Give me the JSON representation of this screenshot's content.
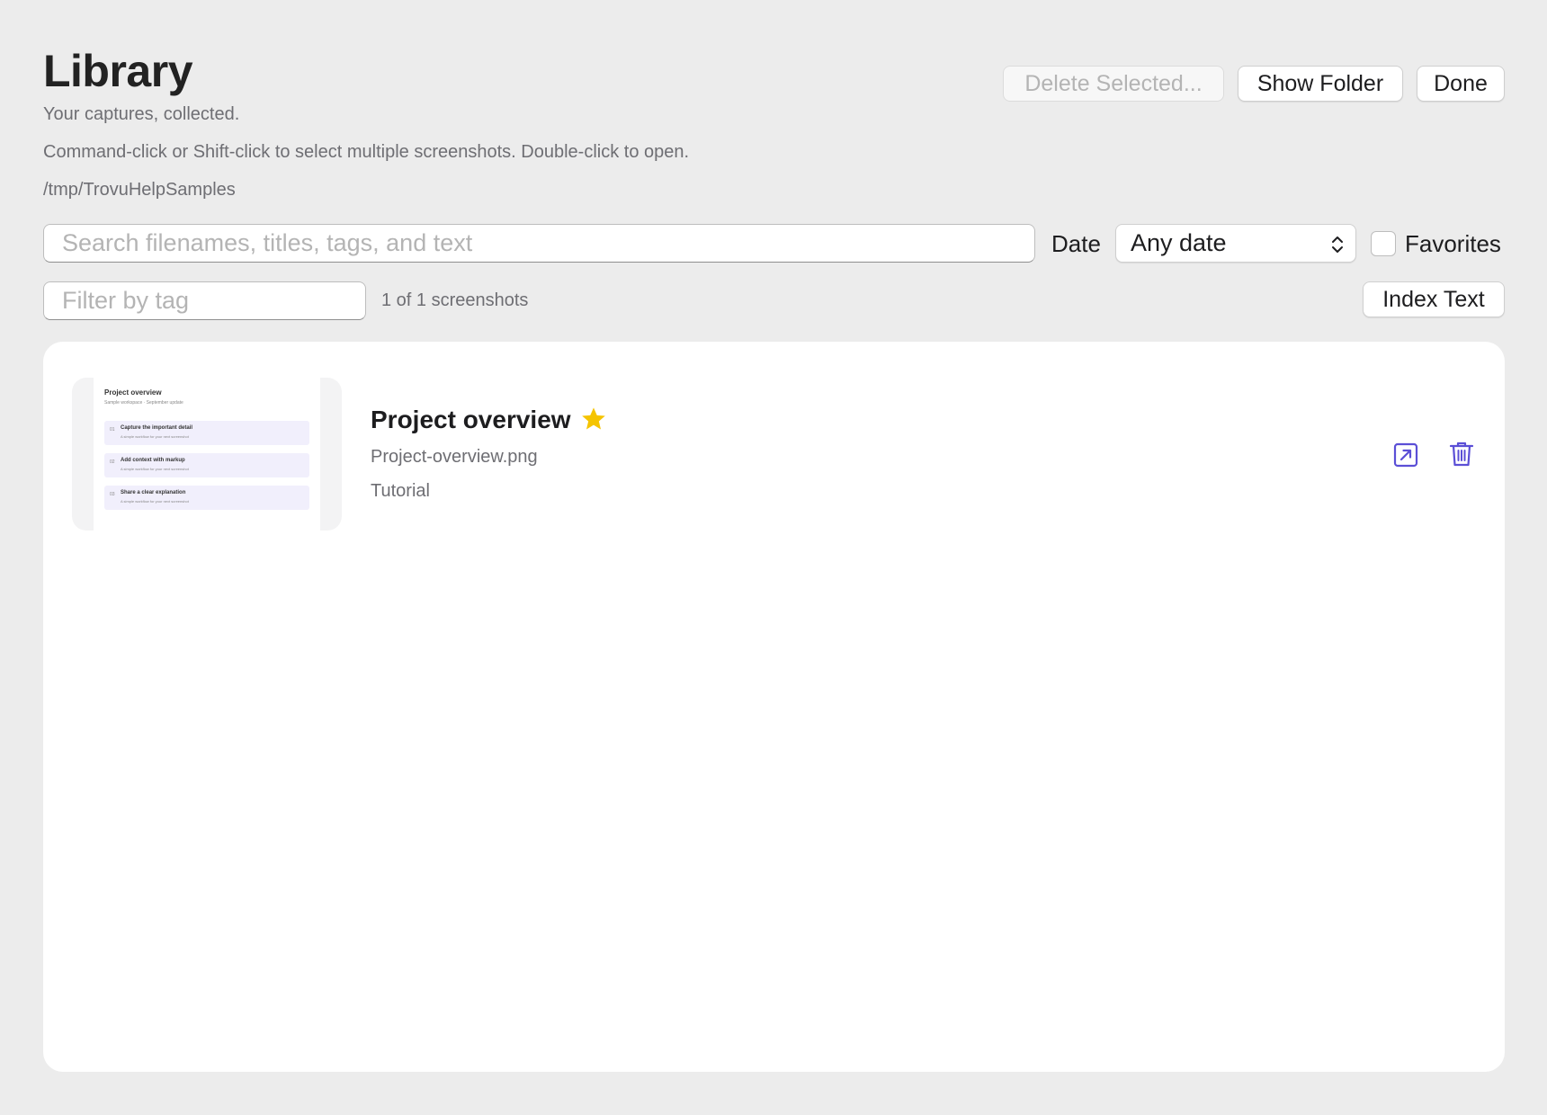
{
  "header": {
    "title": "Library",
    "subtitle": "Your captures, collected.",
    "hint": "Command-click or Shift-click to select multiple screenshots. Double-click to open.",
    "path": "/tmp/TrovuHelpSamples"
  },
  "toolbar": {
    "delete_label": "Delete Selected...",
    "show_folder_label": "Show Folder",
    "done_label": "Done",
    "index_text_label": "Index Text"
  },
  "filters": {
    "search_placeholder": "Search filenames, titles, tags, and text",
    "search_value": "",
    "date_label": "Date",
    "date_value": "Any date",
    "favorites_label": "Favorites",
    "favorites_checked": false,
    "tag_placeholder": "Filter by tag",
    "tag_value": "",
    "count_text": "1 of 1 screenshots"
  },
  "items": [
    {
      "title": "Project overview",
      "favorite": true,
      "filename": "Project-overview.png",
      "tag": "Tutorial",
      "thumbnail": {
        "title": "Project overview",
        "subtitle": "Sample workspace · September update",
        "rows": [
          {
            "num": "01",
            "label": "Capture the important detail",
            "desc": "A simple workflow for your next screenshot"
          },
          {
            "num": "02",
            "label": "Add context with markup",
            "desc": "A simple workflow for your next screenshot"
          },
          {
            "num": "03",
            "label": "Share a clear explanation",
            "desc": "A simple workflow for your next screenshot"
          }
        ]
      }
    }
  ],
  "colors": {
    "background": "#ececec",
    "accent": "#5b4fd6",
    "star": "#f5c400"
  },
  "icons": {
    "star": "star-icon",
    "open": "open-external-icon",
    "trash": "trash-icon",
    "date_chevron": "chevron-updown-icon"
  }
}
